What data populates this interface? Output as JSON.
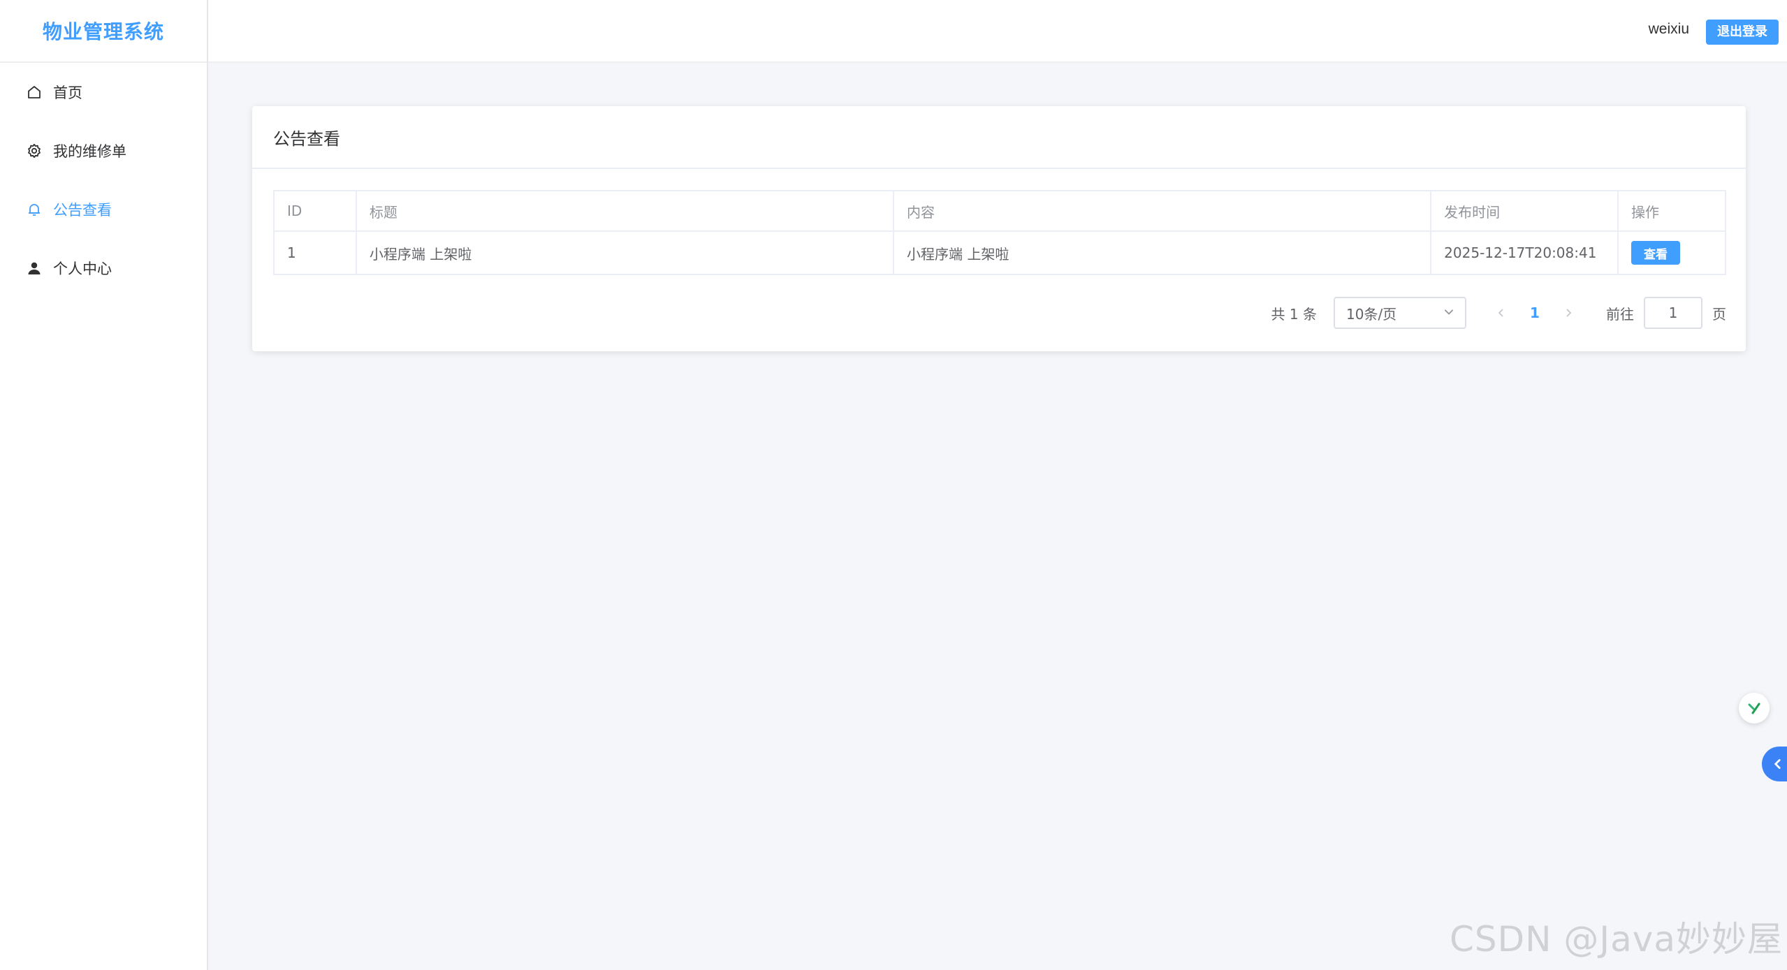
{
  "app": {
    "brand_title": "物业管理系统"
  },
  "sidebar": {
    "items": [
      {
        "label": "首页",
        "icon": "home-icon",
        "active": false
      },
      {
        "label": "我的维修单",
        "icon": "gear-icon",
        "active": false
      },
      {
        "label": "公告查看",
        "icon": "bell-icon",
        "active": true
      },
      {
        "label": "个人中心",
        "icon": "user-icon",
        "active": false
      }
    ]
  },
  "header": {
    "username": "weixiu",
    "logout_label": "退出登录"
  },
  "page": {
    "title": "公告查看"
  },
  "table": {
    "columns": [
      "ID",
      "标题",
      "内容",
      "发布时间",
      "操作"
    ],
    "rows": [
      {
        "id": "1",
        "title": "小程序端 上架啦",
        "content": "小程序端 上架啦",
        "time": "2025-12-17T20:08:41",
        "action_label": "查看"
      }
    ]
  },
  "pagination": {
    "total_text": "共 1 条",
    "page_size": "10条/页",
    "current_page": "1",
    "goto_label": "前往",
    "goto_value": "1",
    "page_suffix": "页"
  },
  "watermark": "CSDN @Java妙妙屋",
  "colors": {
    "primary": "#409eff",
    "background": "#f4f6f9",
    "side_tab": "#3b82f6"
  }
}
